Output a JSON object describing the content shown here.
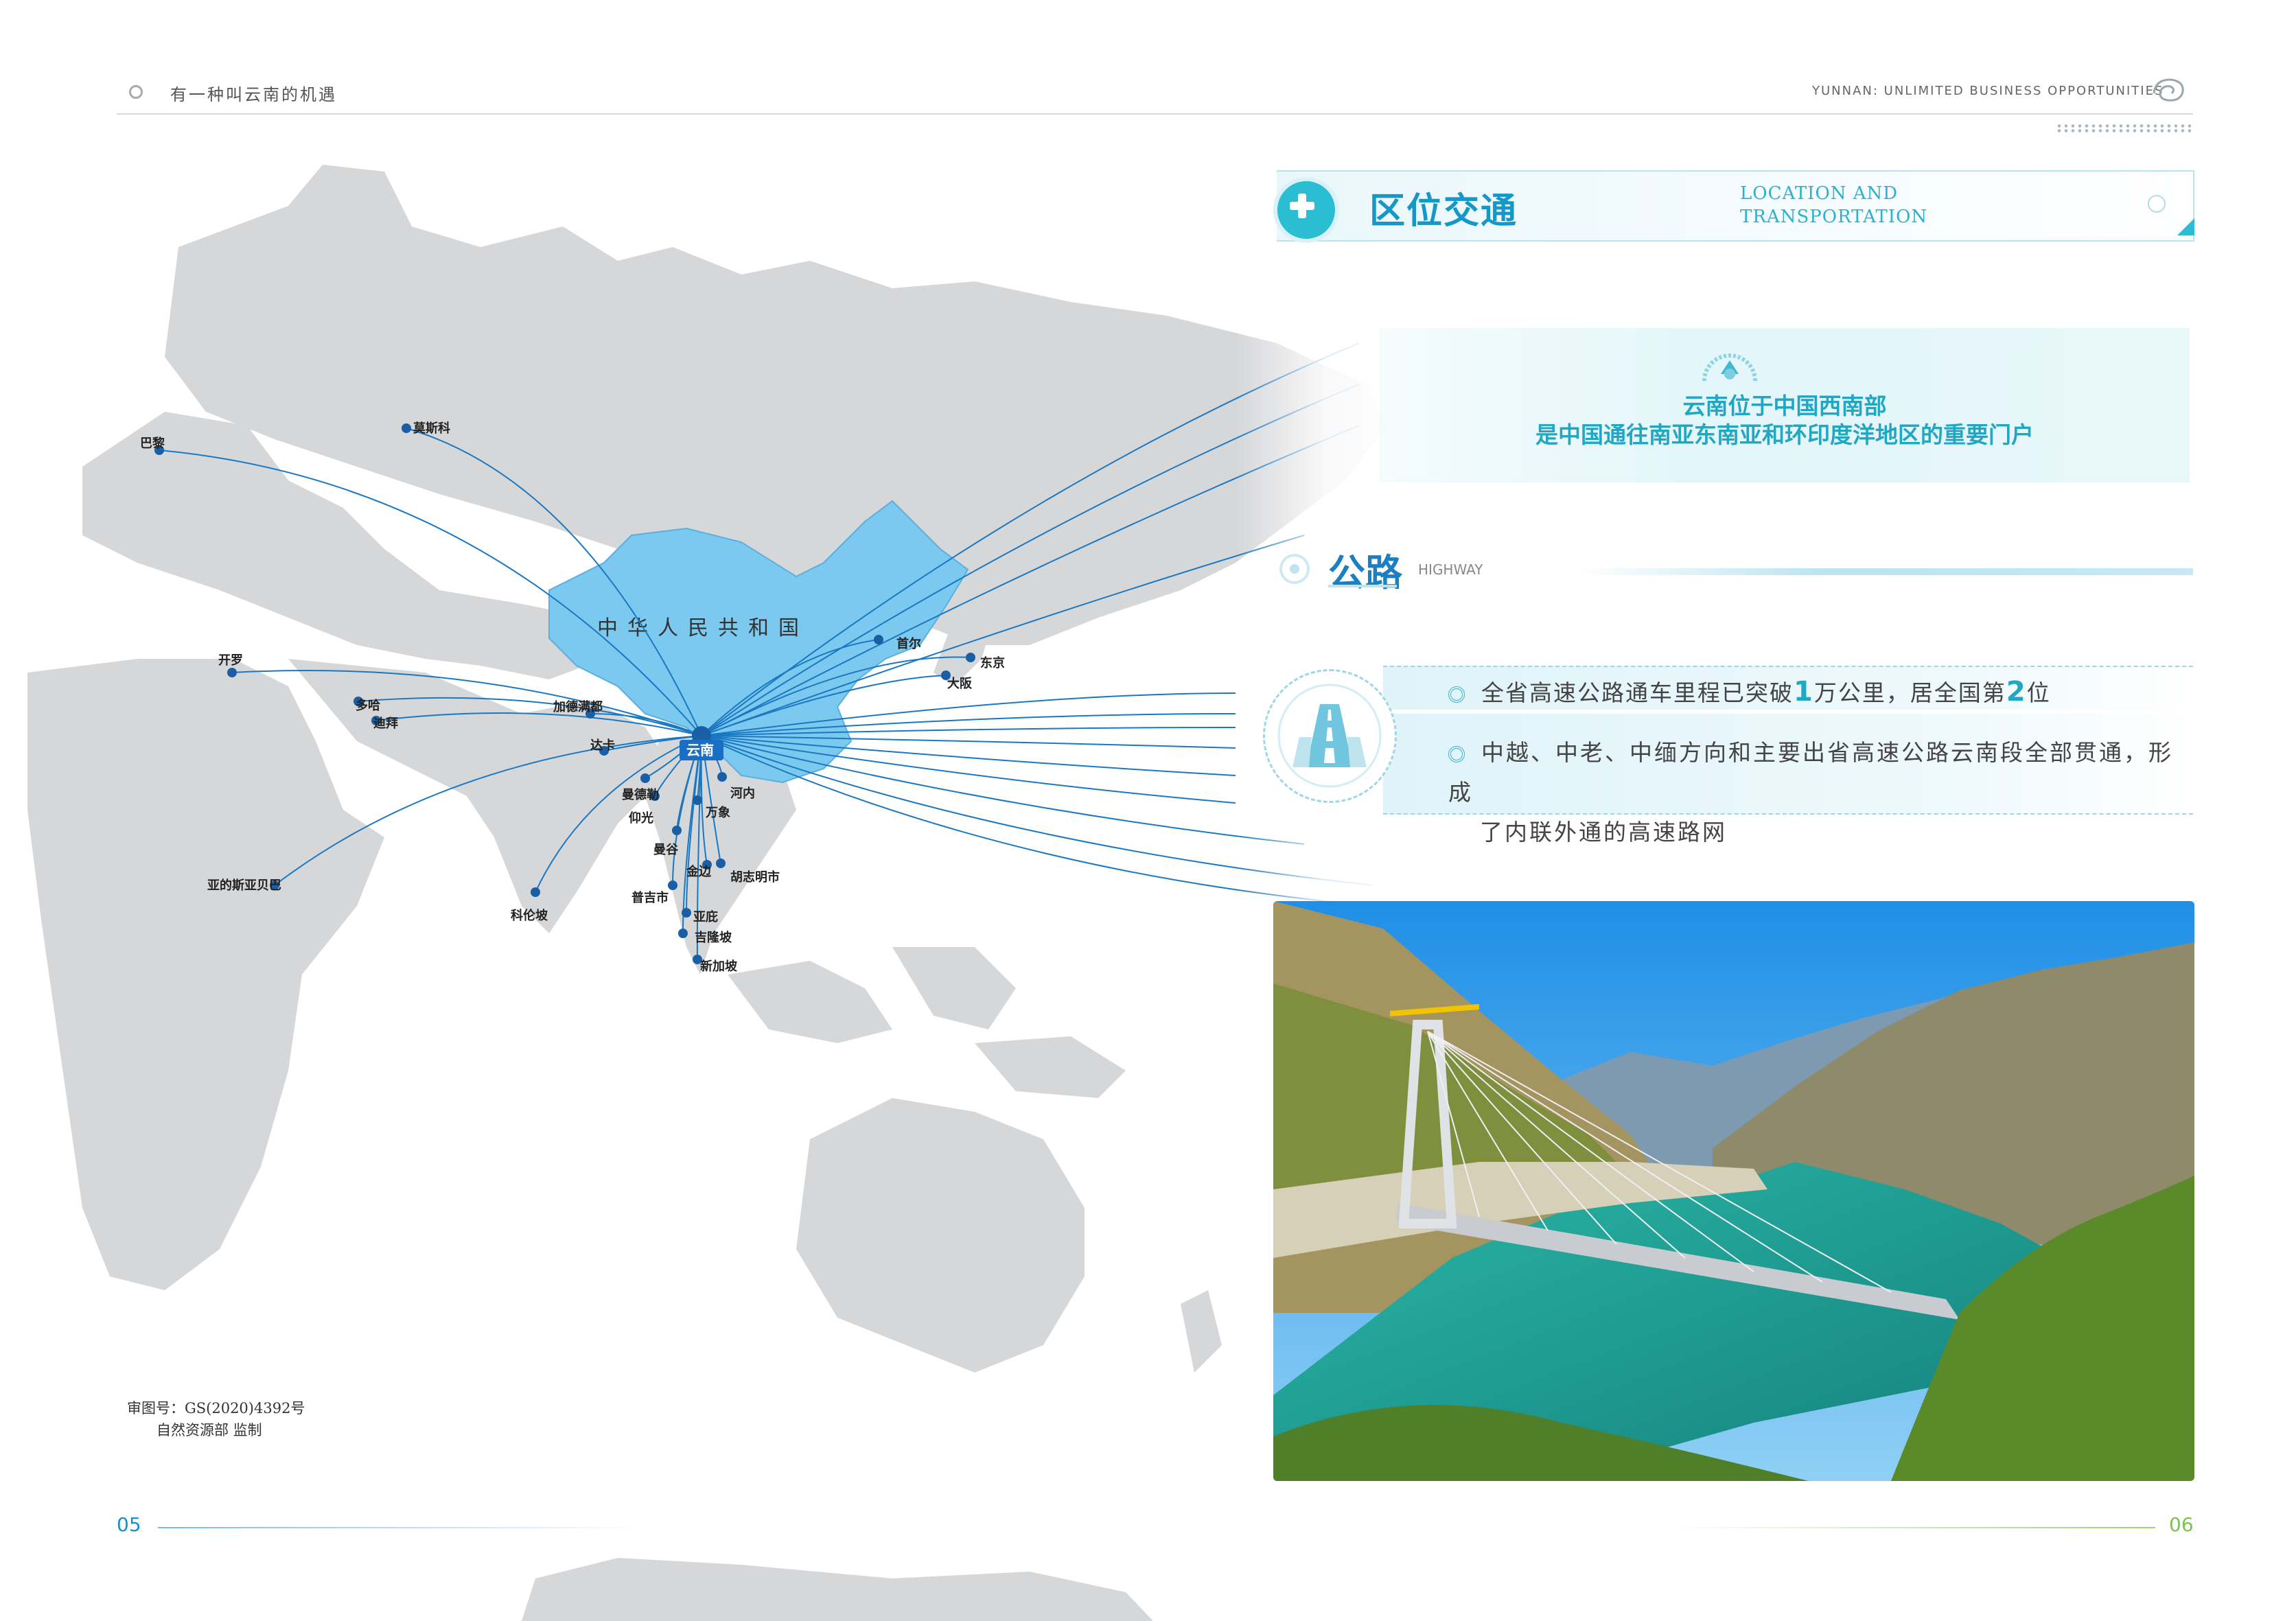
{
  "header": {
    "left_title": "有一种叫云南的机遇",
    "right_title": "YUNNAN: UNLIMITED BUSINESS OPPORTUNITIES"
  },
  "section": {
    "title_cn": "区位交通",
    "title_en_line1": "LOCATION AND",
    "title_en_line2": "TRANSPORTATION"
  },
  "intro": {
    "line1": "云南位于中国西南部",
    "line2": "是中国通往南亚东南亚和环印度洋地区的重要门户"
  },
  "highway": {
    "title_cn": "公路",
    "title_en": "HIGHWAY",
    "bullet1_a": "全省高速公路通车里程已突破",
    "bullet1_num1": "1",
    "bullet1_b": "万公里，居全国第",
    "bullet1_num2": "2",
    "bullet1_c": "位",
    "bullet2_line1": "中越、中老、中缅方向和主要出省高速公路云南段全部贯通，形成",
    "bullet2_line2": "了内联外通的高速路网"
  },
  "map": {
    "country_label": "中华人民共和国",
    "origin": "云南",
    "cities": [
      "巴黎",
      "莫斯科",
      "开罗",
      "多哈",
      "迪拜",
      "加德满都",
      "达卡",
      "亚的斯亚贝巴",
      "科伦坡",
      "首尔",
      "东京",
      "大阪",
      "曼德勒",
      "仰光",
      "万象",
      "河内",
      "曼谷",
      "金边",
      "胡志明市",
      "普吉市",
      "亚庇",
      "吉隆坡",
      "新加坡"
    ],
    "note_line1": "审图号：GS(2020)4392号",
    "note_line2": "自然资源部  监制"
  },
  "footer": {
    "page_left": "05",
    "page_right": "06"
  }
}
